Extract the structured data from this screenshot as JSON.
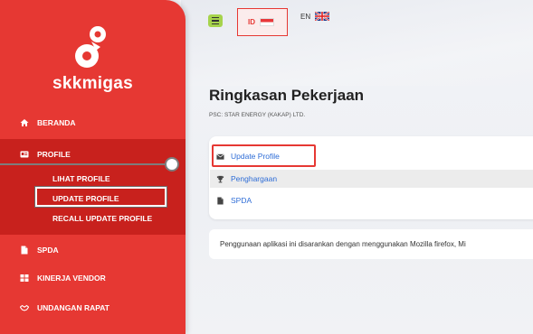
{
  "brand": {
    "name": "skkmigas"
  },
  "sidebar": {
    "items": [
      {
        "label": "BERANDA",
        "icon": "home-icon"
      },
      {
        "label": "PROFILE",
        "icon": "id-card-icon"
      },
      {
        "label": "SPDA",
        "icon": "file-icon"
      },
      {
        "label": "KINERJA VENDOR",
        "icon": "grid-icon"
      },
      {
        "label": "UNDANGAN RAPAT",
        "icon": "handshake-icon"
      }
    ],
    "profile_sub": [
      {
        "label": "LIHAT PROFILE"
      },
      {
        "label": "UPDATE PROFILE"
      },
      {
        "label": "RECALL UPDATE PROFILE"
      }
    ]
  },
  "topbar": {
    "lang_id": "ID",
    "lang_en": "EN"
  },
  "main": {
    "title": "Ringkasan Pekerjaan",
    "subtitle": "PSC: STAR ENERGY (KAKAP) LTD.",
    "links": [
      {
        "label": "Update Profile",
        "icon": "envelope-icon"
      },
      {
        "label": "Penghargaan",
        "icon": "trophy-icon"
      },
      {
        "label": "SPDA",
        "icon": "file-icon"
      }
    ],
    "info": "Penggunaan aplikasi ini disarankan dengan menggunakan Mozilla firefox, Mi"
  },
  "colors": {
    "accent": "#e63833",
    "sidebar_active": "#c8211d",
    "link": "#2d6cd6",
    "menu_button": "#a6d34c"
  }
}
